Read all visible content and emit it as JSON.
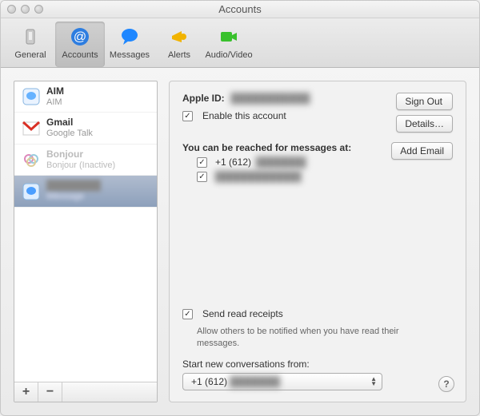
{
  "window": {
    "title": "Accounts"
  },
  "toolbar": {
    "items": [
      {
        "label": "General",
        "icon": "switch-icon",
        "active": false
      },
      {
        "label": "Accounts",
        "icon": "at-icon",
        "active": true
      },
      {
        "label": "Messages",
        "icon": "bubble-icon",
        "active": false
      },
      {
        "label": "Alerts",
        "icon": "megaphone-icon",
        "active": false
      },
      {
        "label": "Audio/Video",
        "icon": "camera-icon",
        "active": false
      }
    ]
  },
  "sidebar": {
    "accounts": [
      {
        "name": "AIM",
        "sub": "AIM",
        "icon": "aim-icon",
        "state": "normal"
      },
      {
        "name": "Gmail",
        "sub": "Google Talk",
        "icon": "gmail-icon",
        "state": "normal"
      },
      {
        "name": "Bonjour",
        "sub": "Bonjour (Inactive)",
        "icon": "bonjour-icon",
        "state": "faded"
      },
      {
        "name": "████████",
        "sub": "iMessage",
        "icon": "imessage-icon",
        "state": "selected"
      }
    ],
    "add_label": "+",
    "remove_label": "−"
  },
  "panel": {
    "apple_id_label": "Apple ID:",
    "apple_id_value": "███████████",
    "sign_out": "Sign Out",
    "details": "Details…",
    "enable_label": "Enable this account",
    "enable_checked": true,
    "reach_heading": "You can be reached for messages at:",
    "add_email": "Add Email",
    "reach_items": [
      {
        "checked": true,
        "prefix": "+1 (612)",
        "rest": "███████"
      },
      {
        "checked": true,
        "prefix": "",
        "rest": "████████████"
      }
    ],
    "read_receipts_checked": true,
    "read_receipts_label": "Send read receipts",
    "read_receipts_sub": "Allow others to be notified when you have read their messages.",
    "start_from_label": "Start new conversations from:",
    "start_from_value_prefix": "+1 (612)",
    "start_from_value_rest": "███████",
    "help_label": "?"
  }
}
